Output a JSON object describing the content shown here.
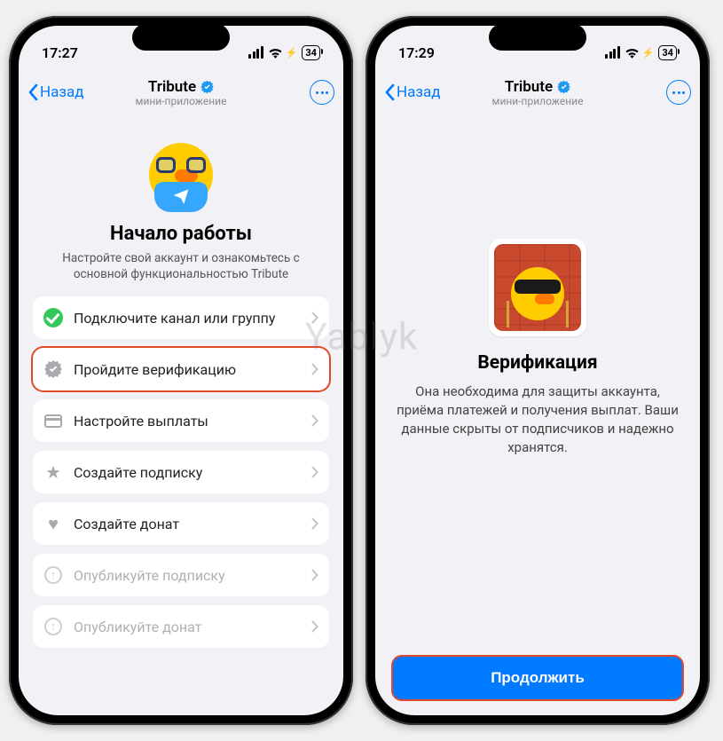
{
  "watermark": "Yablyk",
  "phones": {
    "left": {
      "status": {
        "time": "17:27",
        "battery": "34"
      },
      "nav": {
        "back": "Назад",
        "title": "Tribute",
        "subtitle": "мини-приложение"
      },
      "hero": {
        "title": "Начало работы",
        "subtitle": "Настройте свой аккаунт и ознакомьтесь с основной функциональностью Tribute"
      },
      "items": [
        {
          "label": "Подключите канал или группу",
          "icon": "check",
          "state": "done"
        },
        {
          "label": "Пройдите верификацию",
          "icon": "badge",
          "state": "highlighted"
        },
        {
          "label": "Настройте выплаты",
          "icon": "card",
          "state": "normal"
        },
        {
          "label": "Создайте подписку",
          "icon": "star",
          "state": "normal"
        },
        {
          "label": "Создайте донат",
          "icon": "heart",
          "state": "normal"
        },
        {
          "label": "Опубликуйте подписку",
          "icon": "upload",
          "state": "disabled"
        },
        {
          "label": "Опубликуйте донат",
          "icon": "upload",
          "state": "disabled"
        }
      ]
    },
    "right": {
      "status": {
        "time": "17:29",
        "battery": "34"
      },
      "nav": {
        "back": "Назад",
        "title": "Tribute",
        "subtitle": "мини-приложение"
      },
      "body": {
        "title": "Верификация",
        "text": "Она необходима для защиты аккаунта, приёма платежей и получения выплат. Ваши данные скрыты от подписчиков и надежно хранятся.",
        "cta": "Продолжить"
      }
    }
  }
}
